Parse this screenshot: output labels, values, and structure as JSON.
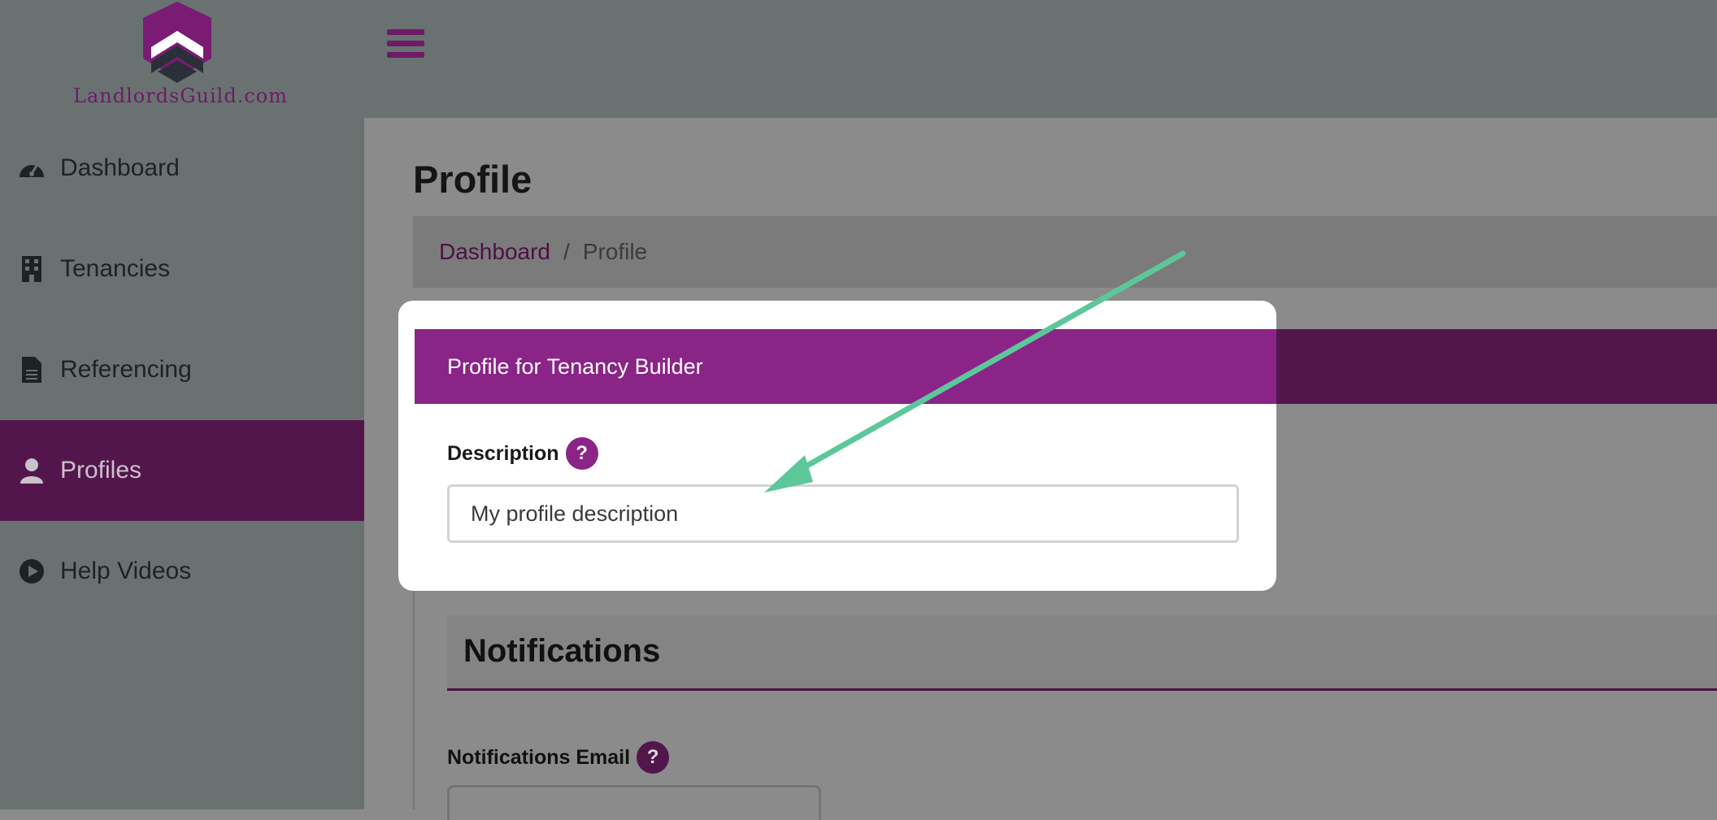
{
  "brand": {
    "logo_text": "LandlordsGuild.com",
    "color": "#6e1a67"
  },
  "sidebar": {
    "items": [
      {
        "label": "Dashboard",
        "icon": "dashboard-gauge-icon"
      },
      {
        "label": "Tenancies",
        "icon": "building-icon"
      },
      {
        "label": "Referencing",
        "icon": "document-icon"
      },
      {
        "label": "Profiles",
        "icon": "user-icon",
        "active": true
      },
      {
        "label": "Help Videos",
        "icon": "play-circle-icon"
      }
    ]
  },
  "header": {
    "menu_icon": "hamburger-icon"
  },
  "page": {
    "title": "Profile",
    "breadcrumb": {
      "home": "Dashboard",
      "separator": "/",
      "current": "Profile"
    }
  },
  "card": {
    "header": "Profile for Tenancy Builder",
    "description_label": "Description",
    "description_value": "My profile description",
    "help_glyph": "?"
  },
  "notifications": {
    "heading": "Notifications",
    "email_label": "Notifications Email",
    "help_glyph": "?"
  },
  "colors": {
    "accent": "#8b2487",
    "arrow": "#5cc79a",
    "active_nav": "#53164c"
  }
}
